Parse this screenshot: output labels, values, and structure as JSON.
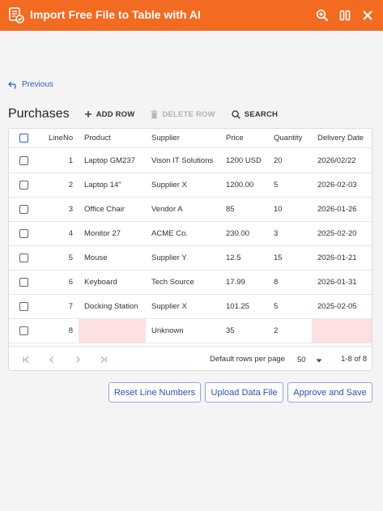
{
  "window": {
    "title": "Import Free File to Table with AI",
    "titlebar_color": "#f26b21"
  },
  "nav": {
    "previous_label": "Previous"
  },
  "toolbar": {
    "heading": "Purchases",
    "add_row": "ADD ROW",
    "delete_row": "DELETE ROW",
    "search": "SEARCH"
  },
  "table": {
    "columns": [
      "LineNo",
      "Product",
      "Supplier",
      "Price",
      "Quantity",
      "Delivery Date"
    ],
    "rows": [
      {
        "line": "1",
        "product": "Laptop GM237",
        "supplier": "Vison IT Solutions",
        "price": "1200 USD",
        "quantity": "20",
        "date": "2026/02/22"
      },
      {
        "line": "2",
        "product": "Laptop 14\"",
        "supplier": "Supplier X",
        "price": "1200.00",
        "quantity": "5",
        "date": "2026-02-03"
      },
      {
        "line": "3",
        "product": "Office Chair",
        "supplier": "Vendor A",
        "price": "85",
        "quantity": "10",
        "date": "2026-01-26"
      },
      {
        "line": "4",
        "product": "Monitor 27",
        "supplier": "ACME Co.",
        "price": "230.00",
        "quantity": "3",
        "date": "2025-02-20"
      },
      {
        "line": "5",
        "product": "Mouse",
        "supplier": "Supplier Y",
        "price": "12.5",
        "quantity": "15",
        "date": "2026-01-21"
      },
      {
        "line": "6",
        "product": "Keyboard",
        "supplier": "Tech Source",
        "price": "17.99",
        "quantity": "8",
        "date": "2026-01-31"
      },
      {
        "line": "7",
        "product": "Docking Station",
        "supplier": "Supplier X",
        "price": "101.25",
        "quantity": "5",
        "date": "2025-02-05"
      },
      {
        "line": "8",
        "product": "",
        "supplier": "Unknown",
        "price": "35",
        "quantity": "2",
        "date": ""
      }
    ],
    "error_color": "#fde0e2"
  },
  "pagination": {
    "rows_per_page_label": "Default rows per page",
    "rows_per_page_value": "50",
    "range_text": "1-8 of 8"
  },
  "actions": {
    "reset": "Reset Line Numbers",
    "upload": "Upload Data File",
    "approve": "Approve and Save"
  }
}
